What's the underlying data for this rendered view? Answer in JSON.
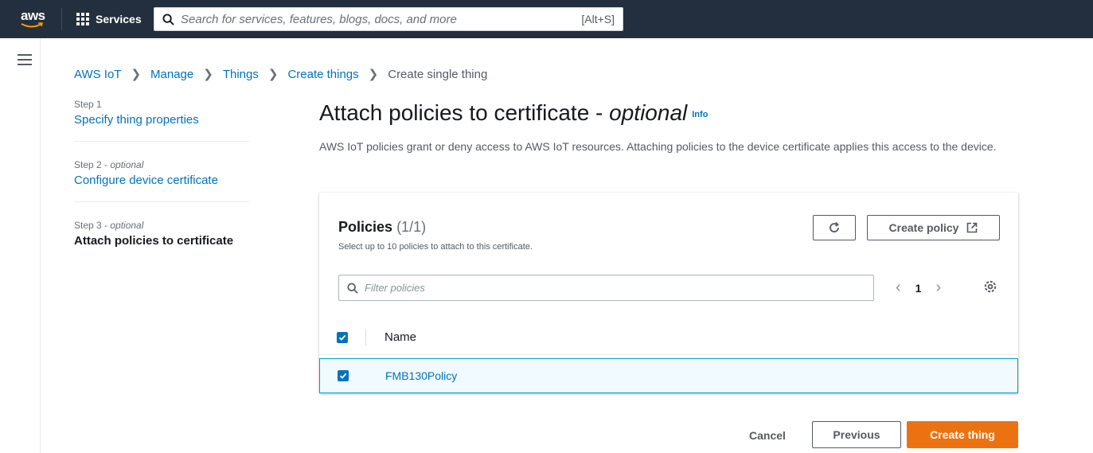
{
  "topnav": {
    "logo_text": "aws",
    "services_label": "Services",
    "search_placeholder": "Search for services, features, blogs, docs, and more",
    "search_shortcut": "[Alt+S]"
  },
  "breadcrumb": [
    {
      "label": "AWS IoT"
    },
    {
      "label": "Manage"
    },
    {
      "label": "Things"
    },
    {
      "label": "Create things"
    },
    {
      "label": "Create single thing"
    }
  ],
  "steps": [
    {
      "number": "Step 1",
      "optional": "",
      "title": "Specify thing properties"
    },
    {
      "number": "Step 2 - ",
      "optional": "optional",
      "title": "Configure device certificate"
    },
    {
      "number": "Step 3 - ",
      "optional": "optional",
      "title": "Attach policies to certificate"
    }
  ],
  "page": {
    "title_main": "Attach policies to certificate - ",
    "title_optional": "optional",
    "info_link": "Info",
    "description": "AWS IoT policies grant or deny access to AWS IoT resources. Attaching policies to the device certificate applies this access to the device."
  },
  "policies": {
    "title": "Policies",
    "count": "(1/1)",
    "subtitle": "Select up to 10 policies to attach to this certificate.",
    "create_policy_label": "Create policy",
    "filter_placeholder": "Filter policies",
    "page_number": "1",
    "column_name": "Name",
    "rows": [
      {
        "name": "FMB130Policy",
        "selected": true
      }
    ]
  },
  "footer": {
    "cancel_label": "Cancel",
    "previous_label": "Previous",
    "create_thing_label": "Create thing"
  },
  "colors": {
    "nav_bg": "#232f3e",
    "link": "#0073bb",
    "primary_button": "#ec7211",
    "selected_row_bg": "#f1faff",
    "selected_row_border": "#00a1c9"
  }
}
